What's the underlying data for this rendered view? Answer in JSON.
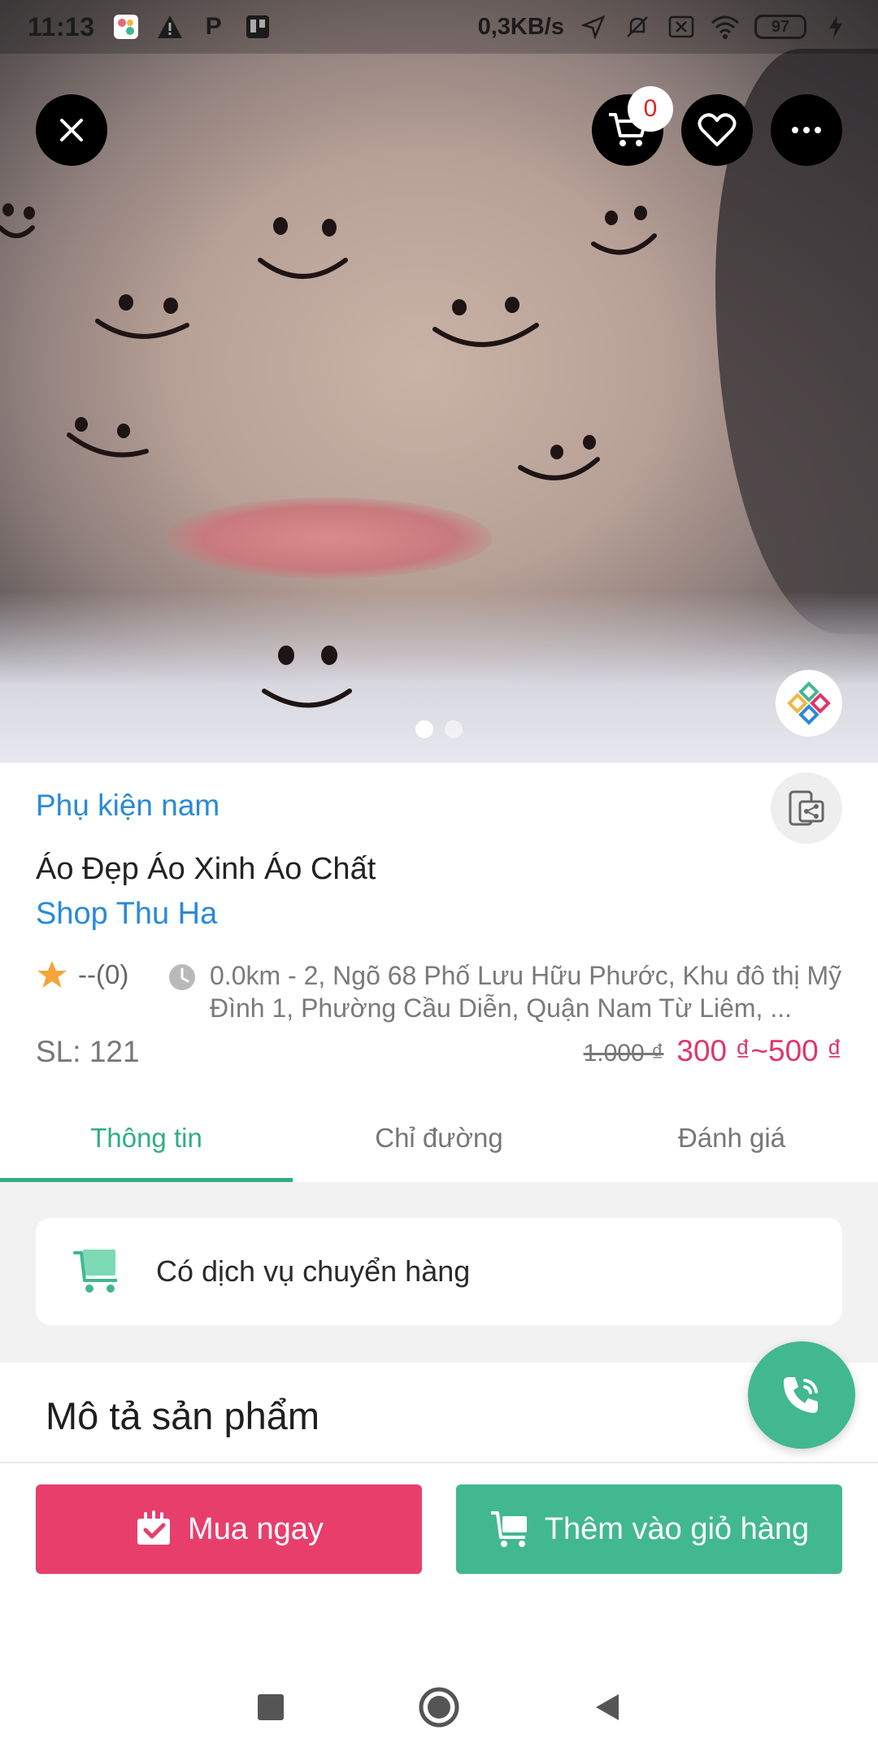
{
  "status_bar": {
    "time": "11:13",
    "speed": "0,3KB/s",
    "battery": "97"
  },
  "header": {
    "cart_count": "0",
    "icons": [
      "close-icon",
      "cart-icon",
      "heart-icon",
      "more-icon"
    ]
  },
  "gallery": {
    "slide_count": 2,
    "active_slide": 1
  },
  "product": {
    "category": "Phụ kiện nam",
    "title": "Áo Đẹp Áo Xinh Áo Chất",
    "shop": "Shop Thu Ha",
    "rating_text": "--(0)",
    "address": "0.0km - 2, Ngõ 68 Phố Lưu Hữu Phước, Khu đô thị Mỹ Đình 1, Phường Cầu Diễn, Quận Nam Từ Liêm, ...",
    "quantity": "SL: 121",
    "old_price": "1.000 ₫",
    "price": "300 ₫~500 ₫"
  },
  "tabs": [
    {
      "label": "Thông tin",
      "active": true
    },
    {
      "label": "Chỉ đường",
      "active": false
    },
    {
      "label": "Đánh giá",
      "active": false
    }
  ],
  "service": {
    "label": "Có dịch vụ chuyển hàng"
  },
  "description": {
    "title": "Mô tả sản phẩm"
  },
  "actions": {
    "buy_now": "Mua ngay",
    "add_to_cart": "Thêm vào giỏ hàng"
  },
  "colors": {
    "accent_green": "#42b890",
    "link_blue": "#2a8ad6",
    "price_pink": "#e0356b",
    "buy_button": "#e83e6c"
  }
}
